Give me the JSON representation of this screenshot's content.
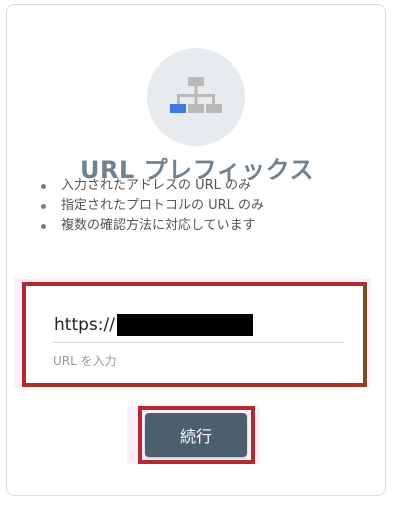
{
  "title": "URL プレフィックス",
  "features": [
    "入力されたアドレスの URL のみ",
    "指定されたプロトコルの URL のみ",
    "複数の確認方法に対応しています"
  ],
  "url_input": {
    "value": "https://",
    "placeholder": "URL を入力"
  },
  "continue_label": "続行",
  "colors": {
    "title": "#6e8291",
    "button": "#4c5f6c",
    "icon_accent": "#3d7be0",
    "highlight_border": "#b12a32"
  },
  "icon": "sitemap-icon"
}
